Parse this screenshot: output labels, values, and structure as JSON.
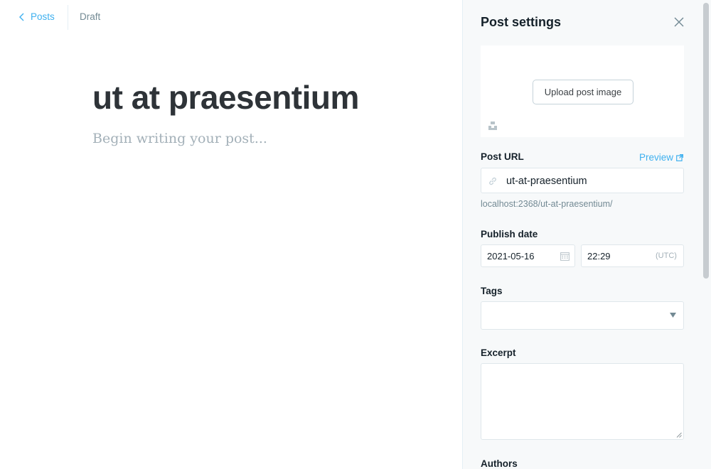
{
  "editor": {
    "back_label": "Posts",
    "status": "Draft",
    "title": "ut at praesentium",
    "body_placeholder": "Begin writing your post..."
  },
  "settings": {
    "title": "Post settings",
    "upload_image_label": "Upload post image",
    "post_url": {
      "label": "Post URL",
      "preview_label": "Preview",
      "slug": "ut-at-praesentium",
      "full_url": "localhost:2368/ut-at-praesentium/"
    },
    "publish_date": {
      "label": "Publish date",
      "date": "2021-05-16",
      "time": "22:29",
      "timezone": "(UTC)"
    },
    "tags": {
      "label": "Tags",
      "value": ""
    },
    "excerpt": {
      "label": "Excerpt",
      "value": ""
    },
    "authors": {
      "label": "Authors"
    }
  },
  "colors": {
    "accent": "#3eb0ef",
    "panel_bg": "#f7f9fa",
    "muted": "#738a94"
  },
  "icons": [
    "chevron-left-icon",
    "close-icon",
    "unsplash-icon",
    "external-link-icon",
    "link-icon",
    "calendar-icon",
    "caret-down-icon"
  ]
}
